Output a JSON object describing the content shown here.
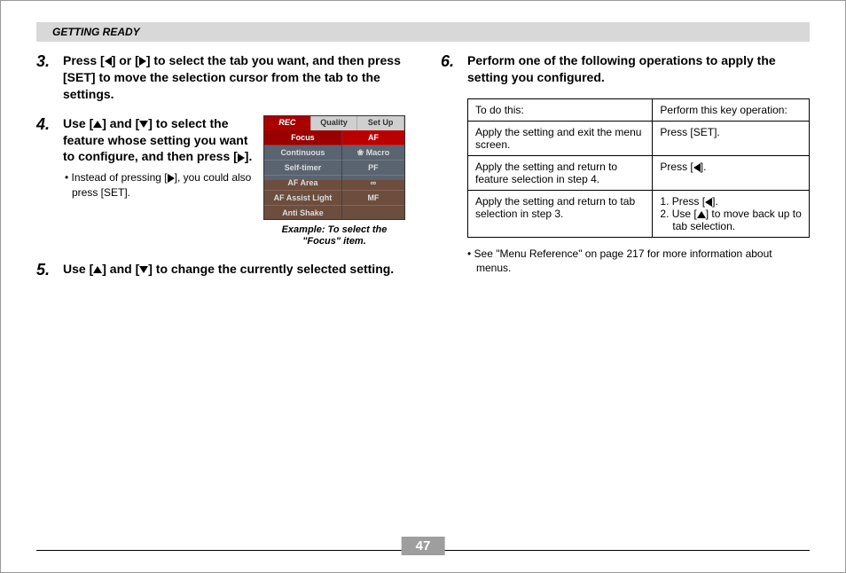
{
  "section_header": "GETTING READY",
  "page_number": "47",
  "steps": {
    "s3": {
      "num": "3.",
      "text_a": "Press [",
      "text_b": "] or [",
      "text_c": "] to select the tab you want, and then press [SET] to move the selection cursor from the tab to the settings."
    },
    "s4": {
      "num": "4.",
      "text_a": "Use [",
      "text_b": "] and [",
      "text_c": "] to select the feature whose setting you want to configure, and then press [",
      "text_d": "].",
      "bullet_a": "• Instead of pressing [",
      "bullet_b": "], you could also press [SET]."
    },
    "s5": {
      "num": "5.",
      "text_a": "Use [",
      "text_b": "] and [",
      "text_c": "] to change the currently selected setting."
    },
    "s6": {
      "num": "6.",
      "text": "Perform one of the following operations to apply the setting you configured."
    }
  },
  "menu_figure": {
    "tabs": {
      "rec": "REC",
      "quality": "Quality",
      "setup": "Set Up"
    },
    "items": [
      "Focus",
      "Continuous",
      "Self-timer",
      "AF Area",
      "AF Assist Light",
      "Anti Shake"
    ],
    "options": [
      "AF",
      "❀ Macro",
      "PF",
      "∞",
      "MF"
    ],
    "caption": "Example: To select the \"Focus\" item."
  },
  "table": {
    "head": {
      "c1": "To do this:",
      "c2": "Perform this key operation:"
    },
    "rows": [
      {
        "c1": "Apply the setting and exit the menu screen.",
        "c2": "Press [SET]."
      },
      {
        "c1": "Apply the setting and return to feature selection in step 4.",
        "c2_a": "Press [",
        "c2_b": "]."
      },
      {
        "c1": "Apply the setting and return to tab selection in step 3.",
        "c2_a": "1. Press [",
        "c2_b": "].",
        "c2_c": "2. Use [",
        "c2_d": "] to move back up to tab selection."
      }
    ]
  },
  "footnote": "• See \"Menu Reference\" on page 217 for more information about menus."
}
